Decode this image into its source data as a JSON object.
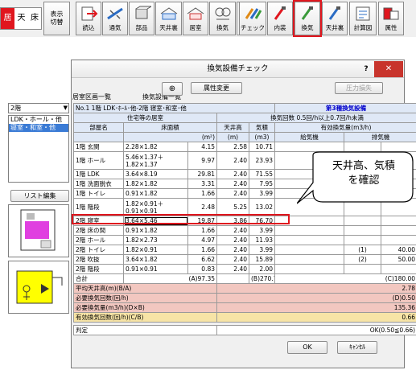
{
  "toolbar": {
    "stamp_left": [
      "居",
      "天",
      "床"
    ],
    "items": [
      {
        "label": "表示\n切替",
        "icon": "view-switch-icon"
      },
      {
        "label": "読込",
        "icon": "load-icon"
      },
      {
        "label": "通気",
        "icon": "ventilation-duct-icon"
      },
      {
        "label": "部品",
        "icon": "parts-icon"
      },
      {
        "label": "天井裏",
        "icon": "ceiling-space-icon"
      },
      {
        "label": "居室",
        "icon": "living-room-icon"
      },
      {
        "label": "換気",
        "icon": "ventilation-icon"
      },
      {
        "label": "チェック",
        "icon": "check-icon"
      },
      {
        "label": "内装",
        "icon": "interior-icon"
      },
      {
        "label": "換気",
        "icon": "ventilation-check-icon"
      },
      {
        "label": "天井裏",
        "icon": "ceiling-check-icon"
      },
      {
        "label": "計算図",
        "icon": "calc-diagram-icon"
      },
      {
        "label": "属性",
        "icon": "attribute-icon"
      }
    ],
    "selected_label": "換気"
  },
  "dialog": {
    "title": "換気設備チェック",
    "help_button": "?",
    "close_button": "✕",
    "left_title": "居室区画一覧",
    "mid_title": "換気設備一覧",
    "floor_select": "2階",
    "room_list": [
      "LDK・ホール・他",
      "寝室・和室・他"
    ],
    "list_edit_button": "リスト編集",
    "attribute_button": "属性変更",
    "pressure_loss_button": "圧力損失",
    "ok_button": "OK",
    "cancel_button": "ｷｬﾝｾﾙ"
  },
  "table": {
    "header_title": "No.1 1階 LDK･ﾎｰﾙ･他-2階 寝室･和室･他",
    "header_type": "第3種換気設備",
    "group_room": "住宅等の居室",
    "rate_label": "換気回数 0.5回/h以上0.7回/h未満",
    "col_room": "部屋名",
    "col_area": "床面積",
    "col_area_unit": "(m²)",
    "col_height": "天井高",
    "col_height_unit": "(m)",
    "col_volume": "気積",
    "col_volume_unit": "(m3)",
    "col_vent": "有効換気量(m3/h)",
    "col_supply": "給気機",
    "col_exhaust": "排気機",
    "rows": [
      {
        "room": "1階 玄関",
        "formula": "2.28×1.82",
        "area": "4.15",
        "height": "2.58",
        "volume": "10.71",
        "no": "",
        "exhaust": ""
      },
      {
        "room": "1階 ホール",
        "formula": "5.46×1.37＋\n1.82×1.37",
        "area": "9.97",
        "height": "2.40",
        "volume": "23.93",
        "no": "",
        "exhaust": ""
      },
      {
        "room": "1階 LDK",
        "formula": "3.64×8.19",
        "area": "29.81",
        "height": "2.40",
        "volume": "71.55",
        "no": "",
        "exhaust": ""
      },
      {
        "room": "1階 洗面脱衣",
        "formula": "1.82×1.82",
        "area": "3.31",
        "height": "2.40",
        "volume": "7.95",
        "no": "",
        "exhaust": ""
      },
      {
        "room": "1階 トイレ",
        "formula": "0.91×1.82",
        "area": "1.66",
        "height": "2.40",
        "volume": "3.99",
        "no": "",
        "exhaust": ""
      },
      {
        "room": "1階 階段",
        "formula": "1.82×0.91＋\n0.91×0.91",
        "area": "2.48",
        "height": "5.25",
        "volume": "13.02",
        "no": "",
        "exhaust": ""
      },
      {
        "room": "2階 寝室",
        "formula": "3.64×5.46",
        "area": "19.87",
        "height": "3.86",
        "volume": "76.70",
        "no": "",
        "exhaust": "",
        "selected": true
      },
      {
        "room": "2階 床の間",
        "formula": "0.91×1.82",
        "area": "1.66",
        "height": "2.40",
        "volume": "3.99",
        "no": "",
        "exhaust": ""
      },
      {
        "room": "2階 ホール",
        "formula": "1.82×2.73",
        "area": "4.97",
        "height": "2.40",
        "volume": "11.93",
        "no": "",
        "exhaust": ""
      },
      {
        "room": "2階 トイレ",
        "formula": "1.82×0.91",
        "area": "1.66",
        "height": "2.40",
        "volume": "3.99",
        "no": "(1)",
        "exhaust": "40.00"
      },
      {
        "room": "2階 吹抜",
        "formula": "3.64×1.82",
        "area": "6.62",
        "height": "2.40",
        "volume": "15.89",
        "no": "(2)",
        "exhaust": "50.00"
      },
      {
        "room": "2階 階段",
        "formula": "0.91×0.91",
        "area": "0.83",
        "height": "2.40",
        "volume": "2.00",
        "no": "",
        "exhaust": ""
      }
    ],
    "total_label": "合計",
    "total_area": "(A)97.35",
    "total_volume": "(B)270.71",
    "total_vent": "(C)180.00",
    "summary": [
      {
        "label": "平均天井高(m)(B/A)",
        "value": "2.78",
        "tone": "pink"
      },
      {
        "label": "必要換気回数(回/h)",
        "value": "(D)0.50",
        "tone": "pink"
      },
      {
        "label": "必要換気量(m3/h)(D×B)",
        "value": "135.36",
        "tone": "pink"
      },
      {
        "label": "有効換気回数(回/h)(C/B)",
        "value": "0.66",
        "tone": "yellow"
      }
    ],
    "judge_label": "判定",
    "judge_value": "OK(0.50≦0.66)"
  },
  "callout": {
    "text": "天井高、気積\nを確認"
  },
  "colors": {
    "selection": "#e0161e",
    "header_blue": "#dfe8f6",
    "pink": "#f2c7c0",
    "yellow": "#f7e4a6",
    "title_blue": "#0000cc"
  }
}
